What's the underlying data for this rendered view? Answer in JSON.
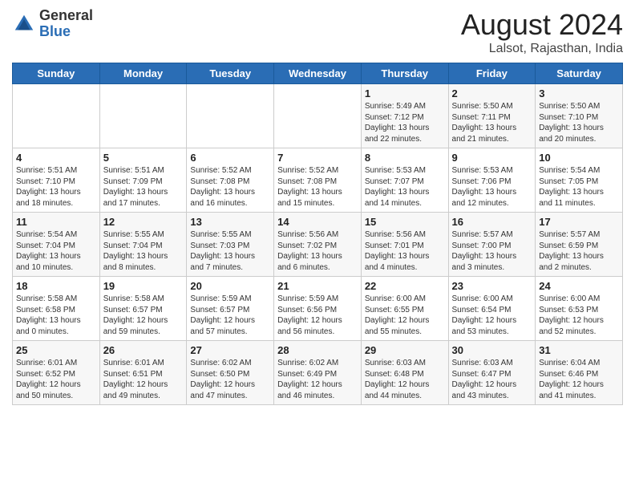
{
  "header": {
    "logo_general": "General",
    "logo_blue": "Blue",
    "month_year": "August 2024",
    "location": "Lalsot, Rajasthan, India"
  },
  "weekdays": [
    "Sunday",
    "Monday",
    "Tuesday",
    "Wednesday",
    "Thursday",
    "Friday",
    "Saturday"
  ],
  "weeks": [
    [
      {
        "day": "",
        "info": ""
      },
      {
        "day": "",
        "info": ""
      },
      {
        "day": "",
        "info": ""
      },
      {
        "day": "",
        "info": ""
      },
      {
        "day": "1",
        "info": "Sunrise: 5:49 AM\nSunset: 7:12 PM\nDaylight: 13 hours\nand 22 minutes."
      },
      {
        "day": "2",
        "info": "Sunrise: 5:50 AM\nSunset: 7:11 PM\nDaylight: 13 hours\nand 21 minutes."
      },
      {
        "day": "3",
        "info": "Sunrise: 5:50 AM\nSunset: 7:10 PM\nDaylight: 13 hours\nand 20 minutes."
      }
    ],
    [
      {
        "day": "4",
        "info": "Sunrise: 5:51 AM\nSunset: 7:10 PM\nDaylight: 13 hours\nand 18 minutes."
      },
      {
        "day": "5",
        "info": "Sunrise: 5:51 AM\nSunset: 7:09 PM\nDaylight: 13 hours\nand 17 minutes."
      },
      {
        "day": "6",
        "info": "Sunrise: 5:52 AM\nSunset: 7:08 PM\nDaylight: 13 hours\nand 16 minutes."
      },
      {
        "day": "7",
        "info": "Sunrise: 5:52 AM\nSunset: 7:08 PM\nDaylight: 13 hours\nand 15 minutes."
      },
      {
        "day": "8",
        "info": "Sunrise: 5:53 AM\nSunset: 7:07 PM\nDaylight: 13 hours\nand 14 minutes."
      },
      {
        "day": "9",
        "info": "Sunrise: 5:53 AM\nSunset: 7:06 PM\nDaylight: 13 hours\nand 12 minutes."
      },
      {
        "day": "10",
        "info": "Sunrise: 5:54 AM\nSunset: 7:05 PM\nDaylight: 13 hours\nand 11 minutes."
      }
    ],
    [
      {
        "day": "11",
        "info": "Sunrise: 5:54 AM\nSunset: 7:04 PM\nDaylight: 13 hours\nand 10 minutes."
      },
      {
        "day": "12",
        "info": "Sunrise: 5:55 AM\nSunset: 7:04 PM\nDaylight: 13 hours\nand 8 minutes."
      },
      {
        "day": "13",
        "info": "Sunrise: 5:55 AM\nSunset: 7:03 PM\nDaylight: 13 hours\nand 7 minutes."
      },
      {
        "day": "14",
        "info": "Sunrise: 5:56 AM\nSunset: 7:02 PM\nDaylight: 13 hours\nand 6 minutes."
      },
      {
        "day": "15",
        "info": "Sunrise: 5:56 AM\nSunset: 7:01 PM\nDaylight: 13 hours\nand 4 minutes."
      },
      {
        "day": "16",
        "info": "Sunrise: 5:57 AM\nSunset: 7:00 PM\nDaylight: 13 hours\nand 3 minutes."
      },
      {
        "day": "17",
        "info": "Sunrise: 5:57 AM\nSunset: 6:59 PM\nDaylight: 13 hours\nand 2 minutes."
      }
    ],
    [
      {
        "day": "18",
        "info": "Sunrise: 5:58 AM\nSunset: 6:58 PM\nDaylight: 13 hours\nand 0 minutes."
      },
      {
        "day": "19",
        "info": "Sunrise: 5:58 AM\nSunset: 6:57 PM\nDaylight: 12 hours\nand 59 minutes."
      },
      {
        "day": "20",
        "info": "Sunrise: 5:59 AM\nSunset: 6:57 PM\nDaylight: 12 hours\nand 57 minutes."
      },
      {
        "day": "21",
        "info": "Sunrise: 5:59 AM\nSunset: 6:56 PM\nDaylight: 12 hours\nand 56 minutes."
      },
      {
        "day": "22",
        "info": "Sunrise: 6:00 AM\nSunset: 6:55 PM\nDaylight: 12 hours\nand 55 minutes."
      },
      {
        "day": "23",
        "info": "Sunrise: 6:00 AM\nSunset: 6:54 PM\nDaylight: 12 hours\nand 53 minutes."
      },
      {
        "day": "24",
        "info": "Sunrise: 6:00 AM\nSunset: 6:53 PM\nDaylight: 12 hours\nand 52 minutes."
      }
    ],
    [
      {
        "day": "25",
        "info": "Sunrise: 6:01 AM\nSunset: 6:52 PM\nDaylight: 12 hours\nand 50 minutes."
      },
      {
        "day": "26",
        "info": "Sunrise: 6:01 AM\nSunset: 6:51 PM\nDaylight: 12 hours\nand 49 minutes."
      },
      {
        "day": "27",
        "info": "Sunrise: 6:02 AM\nSunset: 6:50 PM\nDaylight: 12 hours\nand 47 minutes."
      },
      {
        "day": "28",
        "info": "Sunrise: 6:02 AM\nSunset: 6:49 PM\nDaylight: 12 hours\nand 46 minutes."
      },
      {
        "day": "29",
        "info": "Sunrise: 6:03 AM\nSunset: 6:48 PM\nDaylight: 12 hours\nand 44 minutes."
      },
      {
        "day": "30",
        "info": "Sunrise: 6:03 AM\nSunset: 6:47 PM\nDaylight: 12 hours\nand 43 minutes."
      },
      {
        "day": "31",
        "info": "Sunrise: 6:04 AM\nSunset: 6:46 PM\nDaylight: 12 hours\nand 41 minutes."
      }
    ]
  ]
}
